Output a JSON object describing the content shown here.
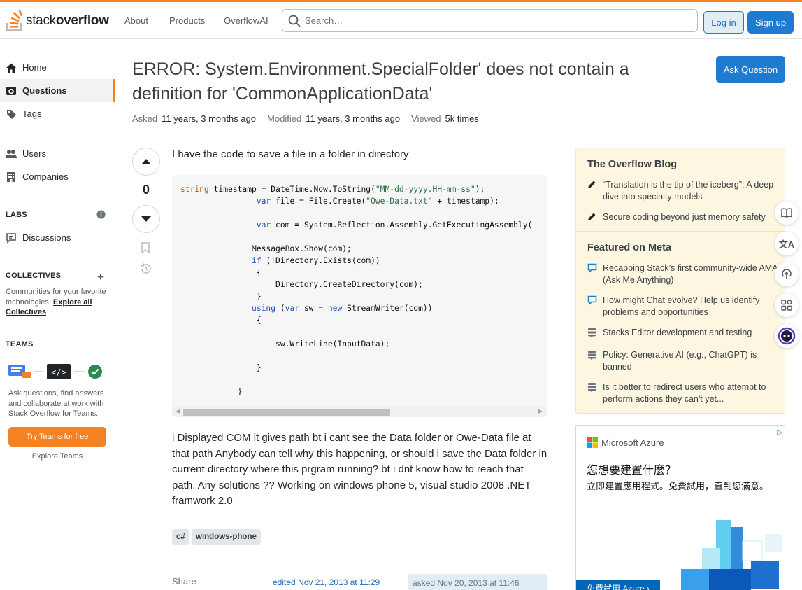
{
  "header": {
    "logo_light": "stack",
    "logo_bold": "overflow",
    "nav": [
      "About",
      "Products",
      "OverflowAI"
    ],
    "search_placeholder": "Search…",
    "login": "Log in",
    "signup": "Sign up"
  },
  "sidebar": {
    "home": "Home",
    "questions": "Questions",
    "tags": "Tags",
    "users": "Users",
    "companies": "Companies",
    "labs_title": "LABS",
    "discussions": "Discussions",
    "collectives_title": "COLLECTIVES",
    "collectives_desc": "Communities for your favorite technologies.",
    "collectives_link": "Explore all Collectives",
    "teams_title": "TEAMS",
    "teams_desc": "Ask questions, find answers and collaborate at work with Stack Overflow for Teams.",
    "teams_button": "Try Teams for free",
    "teams_explore": "Explore Teams"
  },
  "question": {
    "title": "ERROR: System.Environment.SpecialFolder' does not contain a definition for 'CommonApplicationData'",
    "ask_button": "Ask Question",
    "asked_label": "Asked",
    "asked_value": "11 years, 3 months ago",
    "modified_label": "Modified",
    "modified_value": "11 years, 3 months ago",
    "viewed_label": "Viewed",
    "viewed_value": "5k times",
    "vote_count": "0",
    "intro": "I have the code to save a file in a folder in directory",
    "body": "i Displayed COM it gives path bt i cant see the Data folder or Owe-Data file at that path Anybody can tell why this happening, or should i save the Data folder in current directory where this prgram running? bt i dnt know how to reach that path. Any solutions ?? Working on windows phone 5, visual studio 2008 .NET framwork 2.0",
    "tags": [
      "c#",
      "windows-phone"
    ],
    "share": "Share",
    "edited": "edited Nov 21, 2013 at 11:29",
    "asked_card": "asked Nov 20, 2013 at 11:46"
  },
  "blog": {
    "title": "The Overflow Blog",
    "items": [
      "“Translation is the tip of the iceberg”: A deep dive into specialty models",
      "Secure coding beyond just memory safety"
    ],
    "meta_title": "Featured on Meta",
    "meta_items": [
      "Recapping Stack’s first community-wide AMA (Ask Me Anything)",
      "How might Chat evolve? Help us identify problems and opportunities",
      "Stacks Editor development and testing",
      "Policy: Generative AI (e.g., ChatGPT) is banned",
      "Is it better to redirect users who attempt to perform actions they can't yet..."
    ]
  },
  "ad": {
    "brand": "Microsoft Azure",
    "question": "您想要建置什麼？",
    "sub": "立即建置應用程式。免費試用，直到您滿意。",
    "cta": "免費試用 Azure ›"
  },
  "colors": {
    "accent": "#f48225",
    "primary": "#1f7bd1",
    "blog_bg": "#fdf7e2"
  }
}
